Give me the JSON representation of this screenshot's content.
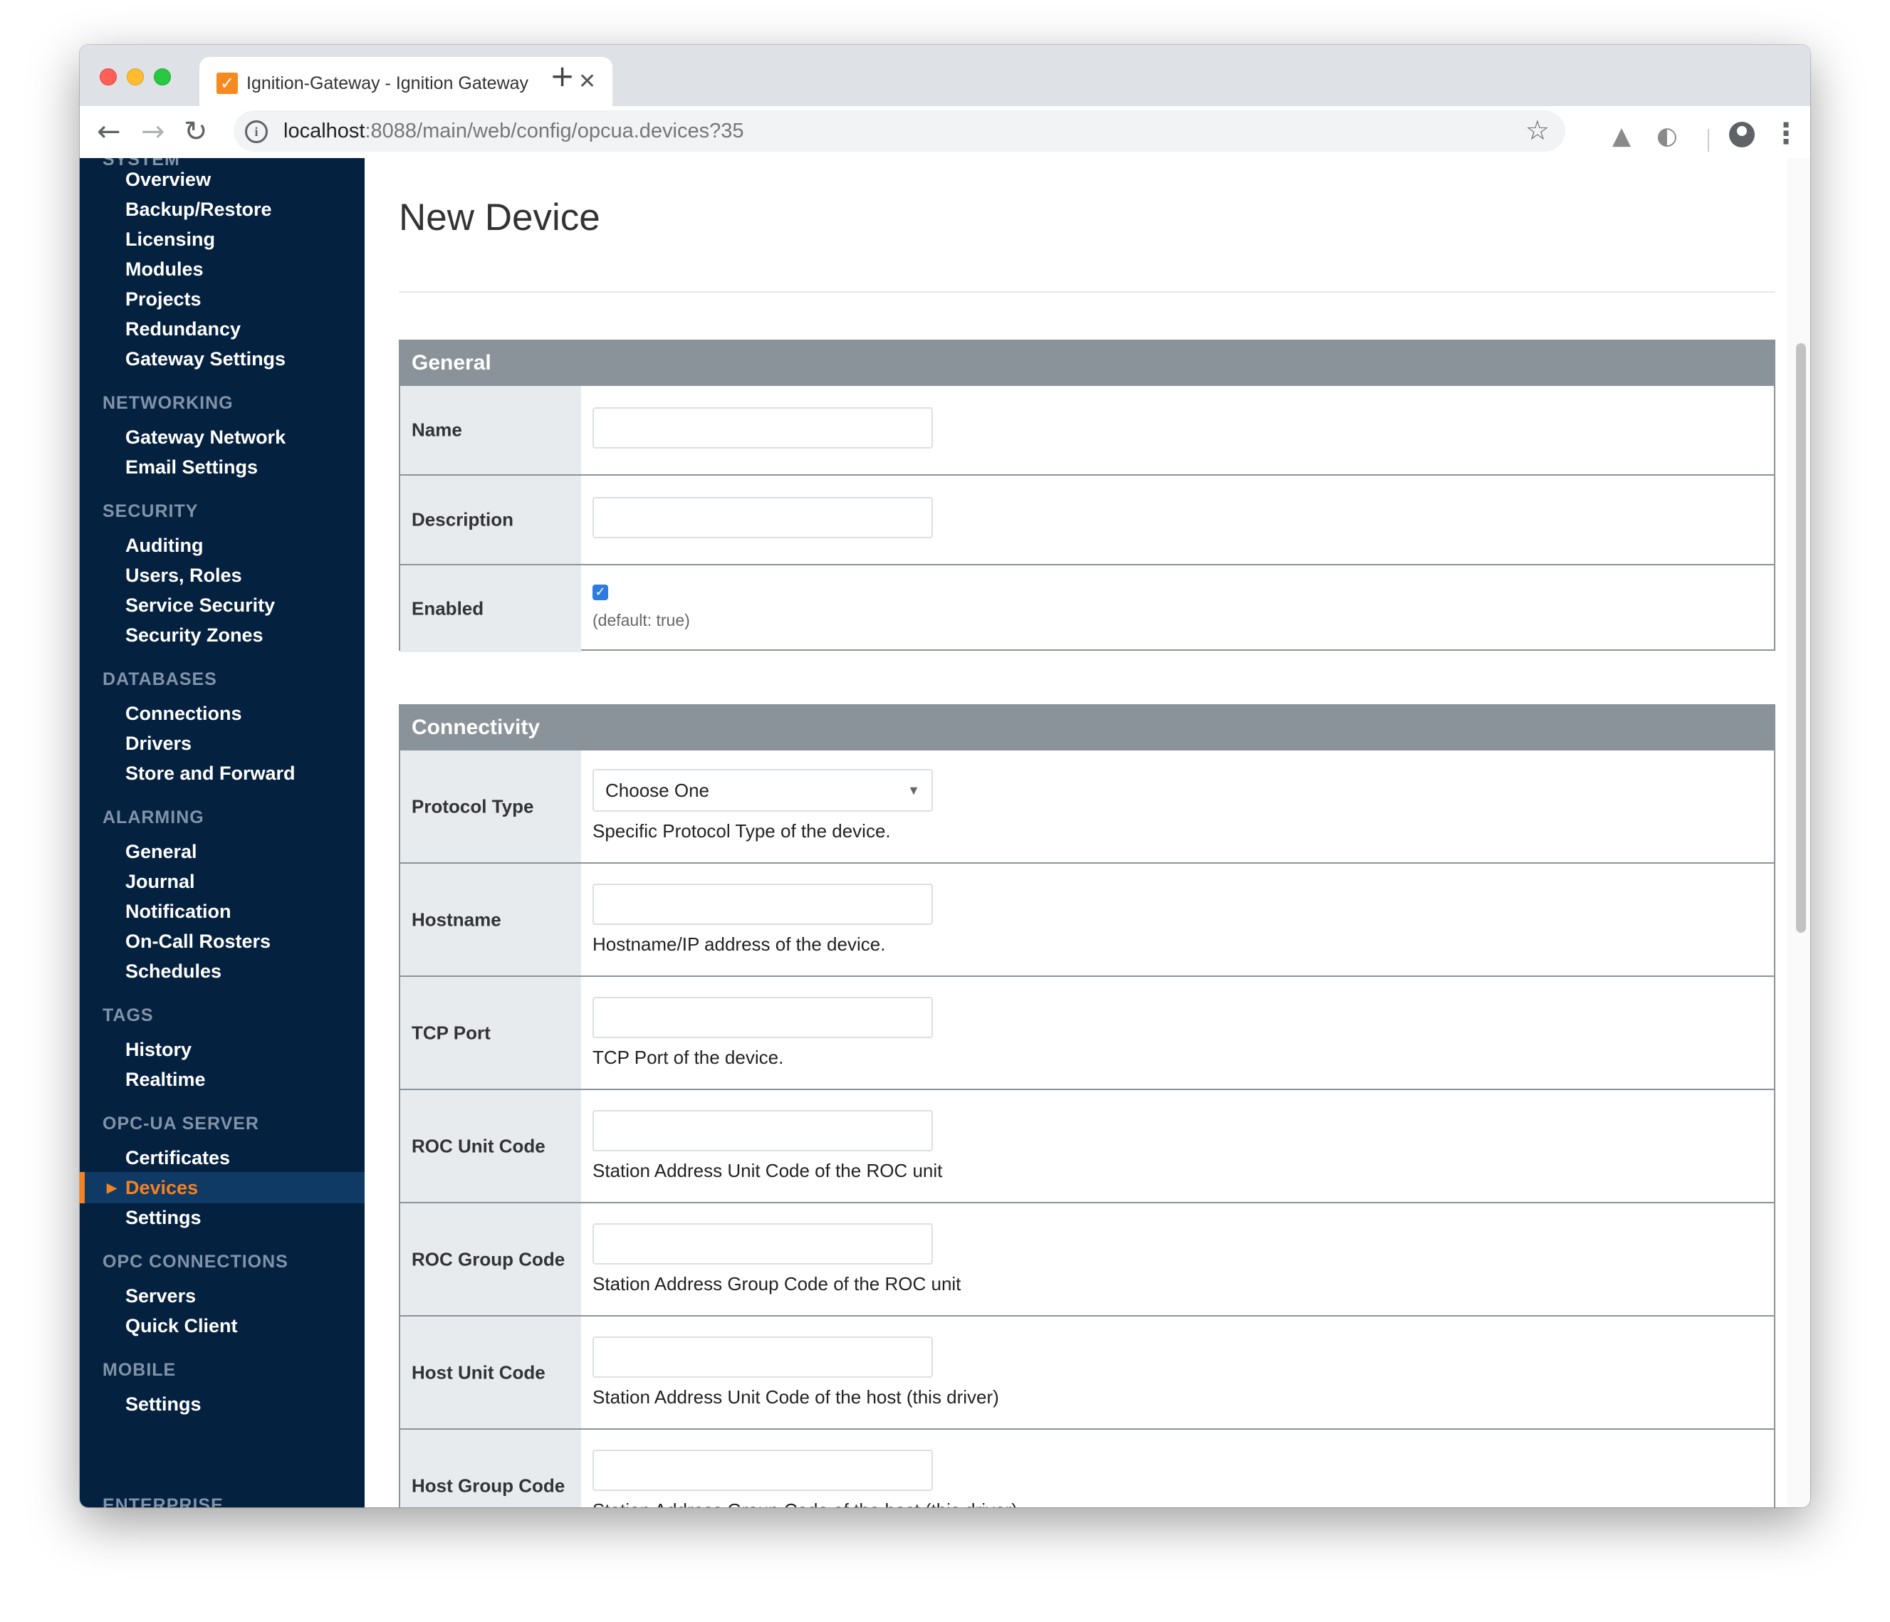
{
  "browser": {
    "tab_title": "Ignition-Gateway - Ignition Gateway",
    "favicon": "ignition-favicon",
    "url_host": "localhost",
    "url_path": ":8088/main/web/config/opcua.devices?35",
    "new_tab_label": "+",
    "close_label": "✕"
  },
  "sidebar": {
    "partial_top_heading": "SYSTEM",
    "sections": [
      {
        "heading": "",
        "items": [
          "Overview",
          "Backup/Restore",
          "Licensing",
          "Modules",
          "Projects",
          "Redundancy",
          "Gateway Settings"
        ]
      },
      {
        "heading": "NETWORKING",
        "items": [
          "Gateway Network",
          "Email Settings"
        ]
      },
      {
        "heading": "SECURITY",
        "items": [
          "Auditing",
          "Users, Roles",
          "Service Security",
          "Security Zones"
        ]
      },
      {
        "heading": "DATABASES",
        "items": [
          "Connections",
          "Drivers",
          "Store and Forward"
        ]
      },
      {
        "heading": "ALARMING",
        "items": [
          "General",
          "Journal",
          "Notification",
          "On-Call Rosters",
          "Schedules"
        ]
      },
      {
        "heading": "TAGS",
        "items": [
          "History",
          "Realtime"
        ]
      },
      {
        "heading": "OPC-UA SERVER",
        "items": [
          "Certificates",
          "Devices",
          "Settings"
        ]
      },
      {
        "heading": "OPC CONNECTIONS",
        "items": [
          "Servers",
          "Quick Client"
        ]
      },
      {
        "heading": "MOBILE",
        "items": [
          "Settings"
        ]
      }
    ],
    "partial_bottom_heading": "ENTERPRISE",
    "active_item": "Devices",
    "active_color": "#f58220"
  },
  "page": {
    "title": "New Device"
  },
  "general": {
    "header": "General",
    "name_label": "Name",
    "name_value": "",
    "description_label": "Description",
    "description_value": "",
    "enabled_label": "Enabled",
    "enabled_checked": true,
    "enabled_default": "(default: true)"
  },
  "connectivity": {
    "header": "Connectivity",
    "protocol_label": "Protocol Type",
    "protocol_value": "Choose One",
    "protocol_help": "Specific Protocol Type of the device.",
    "hostname_label": "Hostname",
    "hostname_help": "Hostname/IP address of the device.",
    "tcp_label": "TCP Port",
    "tcp_help": "TCP Port of the device.",
    "roc_unit_label": "ROC Unit Code",
    "roc_unit_help": "Station Address Unit Code of the ROC unit",
    "roc_group_label": "ROC Group Code",
    "roc_group_help": "Station Address Group Code of the ROC unit",
    "host_unit_label": "Host Unit Code",
    "host_unit_help": "Station Address Unit Code of the host (this driver)",
    "host_group_label": "Host Group Code",
    "host_group_help": "Station Address Group Code of the host (this driver)"
  },
  "colors": {
    "sidebar_bg": "#052140",
    "section_header_bg": "#8a9399",
    "label_bg": "#e7ebee",
    "accent": "#f58220"
  }
}
